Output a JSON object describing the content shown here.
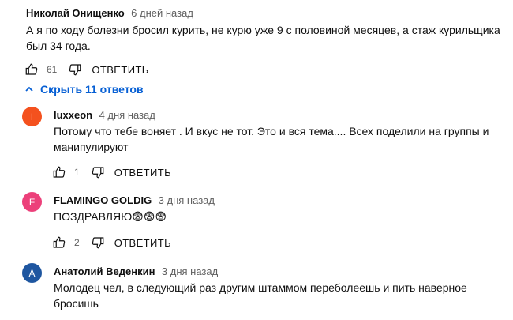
{
  "top_comment": {
    "author": "Николай Онищенко",
    "time": "6 дней назад",
    "text": "А я по ходу болезни бросил курить, не курю уже 9 с половиной месяцев, а стаж курильщика был 34 года.",
    "likes": "61",
    "reply_label": "ОТВЕТИТЬ"
  },
  "toggle_replies_label": "Скрыть 11 ответов",
  "replies": [
    {
      "avatar_letter": "l",
      "avatar_color": "#f4511e",
      "author": "luxxeon",
      "time": "4 дня назад",
      "text": "Потому что тебе воняет . И вкус не тот. Это и вся тема.... Всех поделили на группы и манипулируют",
      "likes": "1",
      "reply_label": "ОТВЕТИТЬ"
    },
    {
      "avatar_letter": "F",
      "avatar_color": "#ec407a",
      "author": "FLAMINGO GOLDIG",
      "time": "3 дня назад",
      "text": "ПОЗДРАВЛЯЮ😨😨😨",
      "likes": "2",
      "reply_label": "ОТВЕТИТЬ"
    },
    {
      "avatar_letter": "А",
      "avatar_color": "#1e56a0",
      "author": "Анатолий Веденкин",
      "time": "3 дня назад",
      "text": "Молодец чел, в следующий раз другим штаммом переболеешь и пить наверное бросишь",
      "likes": "",
      "reply_label": ""
    }
  ]
}
